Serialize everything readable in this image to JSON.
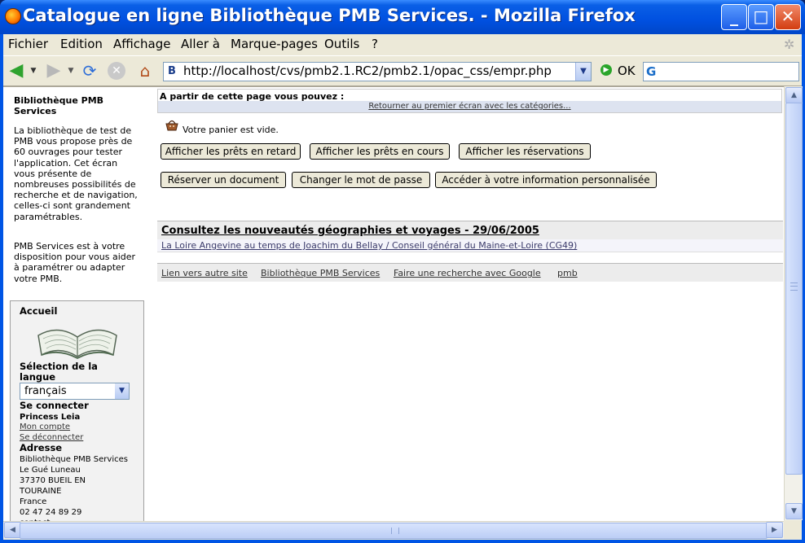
{
  "window": {
    "title": "Catalogue en ligne Bibliothèque PMB Services. - Mozilla Firefox",
    "minimize_glyph": "_",
    "maximize_glyph": "□",
    "close_glyph": "✕"
  },
  "menubar": {
    "items": [
      "Fichier",
      "Edition",
      "Affichage",
      "Aller à",
      "Marque-pages",
      "Outils",
      "?"
    ]
  },
  "toolbar": {
    "back_icon": "back-arrow-icon",
    "forward_icon": "forward-arrow-icon",
    "reload_icon": "reload-icon",
    "stop_icon": "stop-icon",
    "home_icon": "home-icon",
    "url": "http://localhost/cvs/pmb2.1.RC2/pmb2.1/opac_css/empr.php",
    "go_label": "OK",
    "search_engine_glyph": "G"
  },
  "sidebar": {
    "library_title": "Bibliothèque PMB Services",
    "description": "La bibliothèque de test de PMB vous propose près de 60 ouvrages pour tester l'application. Cet écran vous présente de nombreuses possibilités de recherche et de navigation, celles-ci sont grandement paramétrables.",
    "description2": "PMB Services est à votre disposition pour vous aider à paramétrer ou adapter votre PMB.",
    "home_label": "Accueil",
    "language_heading": "Sélection de la langue",
    "language_value": "français",
    "connect_heading": "Se connecter",
    "user_name": "Princess Leia",
    "my_account_link": "Mon compte",
    "logout_link": "Se déconnecter",
    "address_heading": "Adresse",
    "address_lines": [
      "Bibliothèque PMB Services",
      "Le Gué Luneau",
      "37370 BUEIL EN",
      "TOURAINE",
      "France",
      "02 47 24 89 29",
      "contact"
    ]
  },
  "content": {
    "info_title": "A partir de cette page vous pouvez :",
    "info_link": "Retourner au premier écran avec les catégories...",
    "basket_text": "Votre panier est vide.",
    "buttons_row1": [
      "Afficher les prêts en retard",
      "Afficher les prêts en cours",
      "Afficher les réservations"
    ],
    "buttons_row2": [
      "Réserver un document",
      "Changer le mot de passe",
      "Accéder à votre information personnalisée"
    ],
    "news_title": "Consultez les nouveautés géographies et voyages - 29/06/2005",
    "news_item": "La Loire Angevine au temps de Joachim du Bellay / Conseil général du Maine-et-Loire (CG49)",
    "footer_links": [
      "Lien vers autre site",
      "Bibliothèque PMB Services",
      "Faire une recherche avec Google",
      "pmb"
    ]
  },
  "colors": {
    "titlebar": "#0050e0",
    "chrome": "#ece9d8",
    "info_bar": "#dde3f0",
    "news_bg": "#ececec"
  }
}
